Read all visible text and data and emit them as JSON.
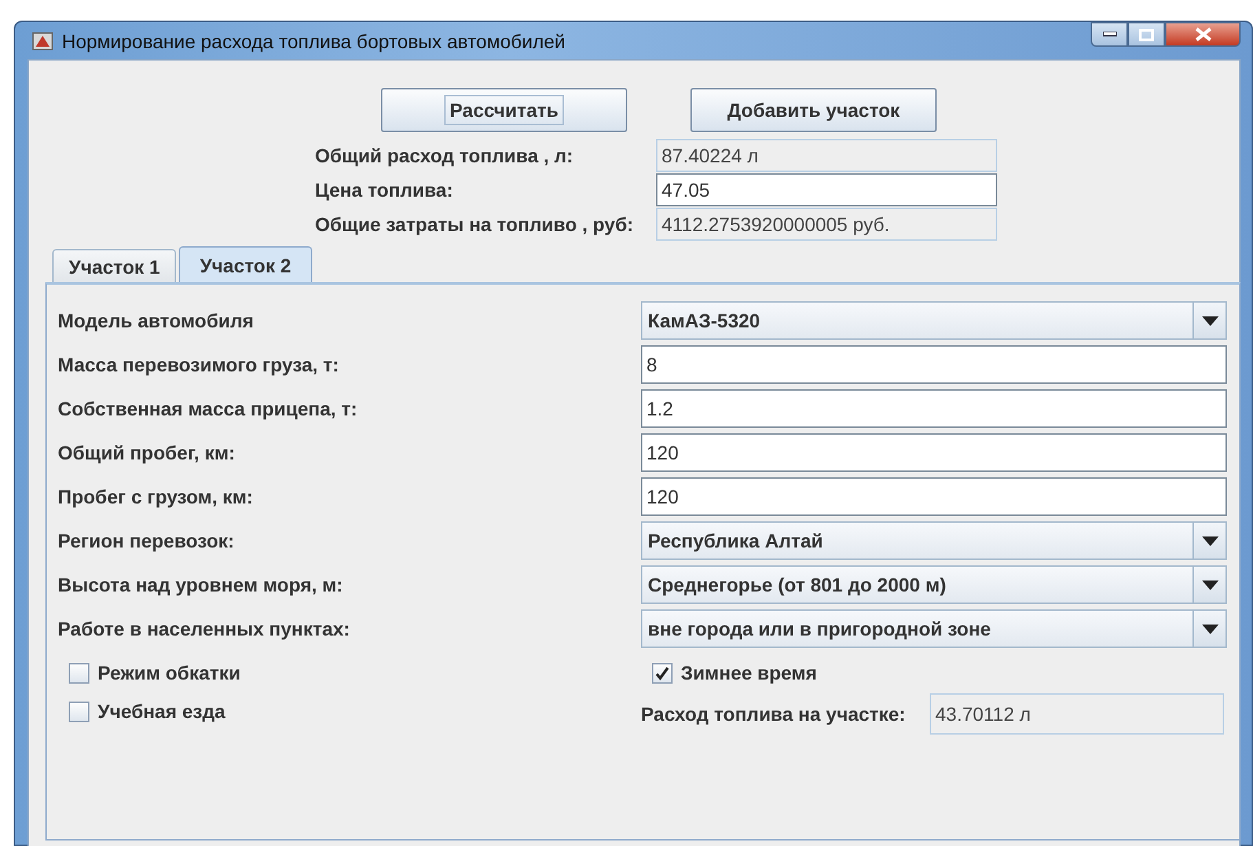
{
  "window": {
    "title": "Нормирование расхода топлива бортовых автомобилей"
  },
  "buttons": [
    {
      "label": "Рассчитать",
      "focused": true
    },
    {
      "label": "Добавить участок",
      "focused": false
    }
  ],
  "summary": [
    {
      "label": "Общий расход топлива , л:",
      "value": "87.40224 л",
      "kind": "readonly"
    },
    {
      "label": "Цена топлива:",
      "value": "47.05",
      "kind": "input"
    },
    {
      "label": "Общие затраты на топливо , руб:",
      "value": "4112.2753920000005 руб.",
      "kind": "readonly"
    }
  ],
  "tabs": [
    {
      "label": "Участок 1",
      "selected": false
    },
    {
      "label": "Участок 2",
      "selected": true
    }
  ],
  "fields": [
    {
      "label": "Модель автомобиля",
      "value": "КамАЗ-5320",
      "kind": "combo"
    },
    {
      "label": "Масса перевозимого груза, т:",
      "value": "8",
      "kind": "text"
    },
    {
      "label": "Собственная масса прицепа, т:",
      "value": "1.2",
      "kind": "text"
    },
    {
      "label": "Общий пробег, км:",
      "value": "120",
      "kind": "text"
    },
    {
      "label": "Пробег с грузом, км:",
      "value": "120",
      "kind": "text"
    },
    {
      "label": "Регион перевозок:",
      "value": "Республика Алтай",
      "kind": "combo"
    },
    {
      "label": "Высота над уровнем моря, м:",
      "value": "Среднегорье (от 801 до 2000 м)",
      "kind": "combo"
    },
    {
      "label": "Работе в населенных пунктах:",
      "value": "вне города или в пригородной зоне",
      "kind": "combo"
    }
  ],
  "extras": [
    {
      "kind": "checkbox",
      "label": "Режим обкатки",
      "checked": false
    },
    {
      "kind": "checkbox",
      "label": "Зимнее время",
      "checked": true
    },
    {
      "kind": "checkbox",
      "label": "Учебная езда",
      "checked": false
    },
    {
      "kind": "output",
      "label": "Расход топлива на участке:",
      "value": "43.70112 л"
    }
  ]
}
